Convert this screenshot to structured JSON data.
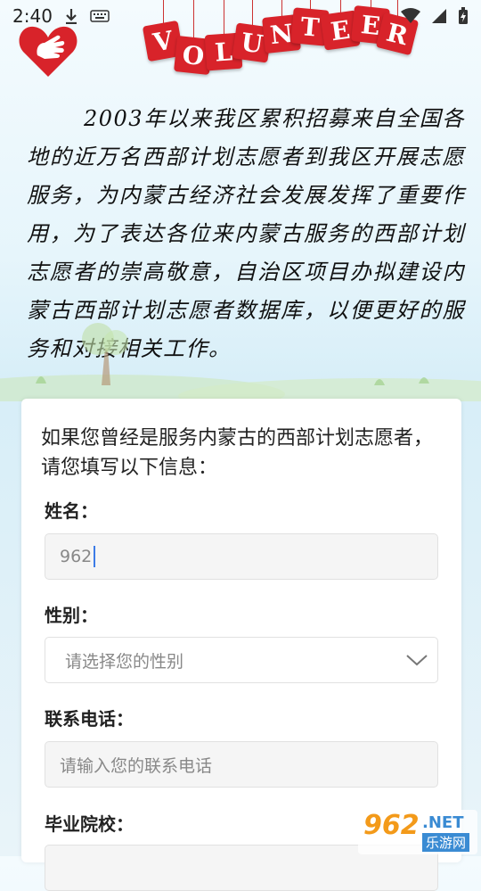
{
  "status_bar": {
    "time": "2:40"
  },
  "banner": {
    "letters": [
      "V",
      "O",
      "L",
      "U",
      "N",
      "T",
      "E",
      "E",
      "R"
    ]
  },
  "intro_text": "2003年以来我区累积招募来自全国各地的近万名西部计划志愿者到我区开展志愿服务，为内蒙古经济社会发展发挥了重要作用，为了表达各位来内蒙古服务的西部计划志愿者的崇高敬意，自治区项目办拟建设内蒙古西部计划志愿者数据库，以便更好的服务和对接相关工作。",
  "form": {
    "intro": "如果您曾经是服务内蒙古的西部计划志愿者，请您填写以下信息：",
    "name_label": "姓名：",
    "name_value": "962",
    "gender_label": "性别：",
    "gender_placeholder": "请选择您的性别",
    "phone_label": "联系电话：",
    "phone_placeholder": "请输入您的联系电话",
    "school_label": "毕业院校："
  },
  "watermark": {
    "number": "962",
    "net": ".NET",
    "cn": "乐游网"
  },
  "colors": {
    "accent": "#d8232a",
    "caret": "#3c7be7"
  }
}
